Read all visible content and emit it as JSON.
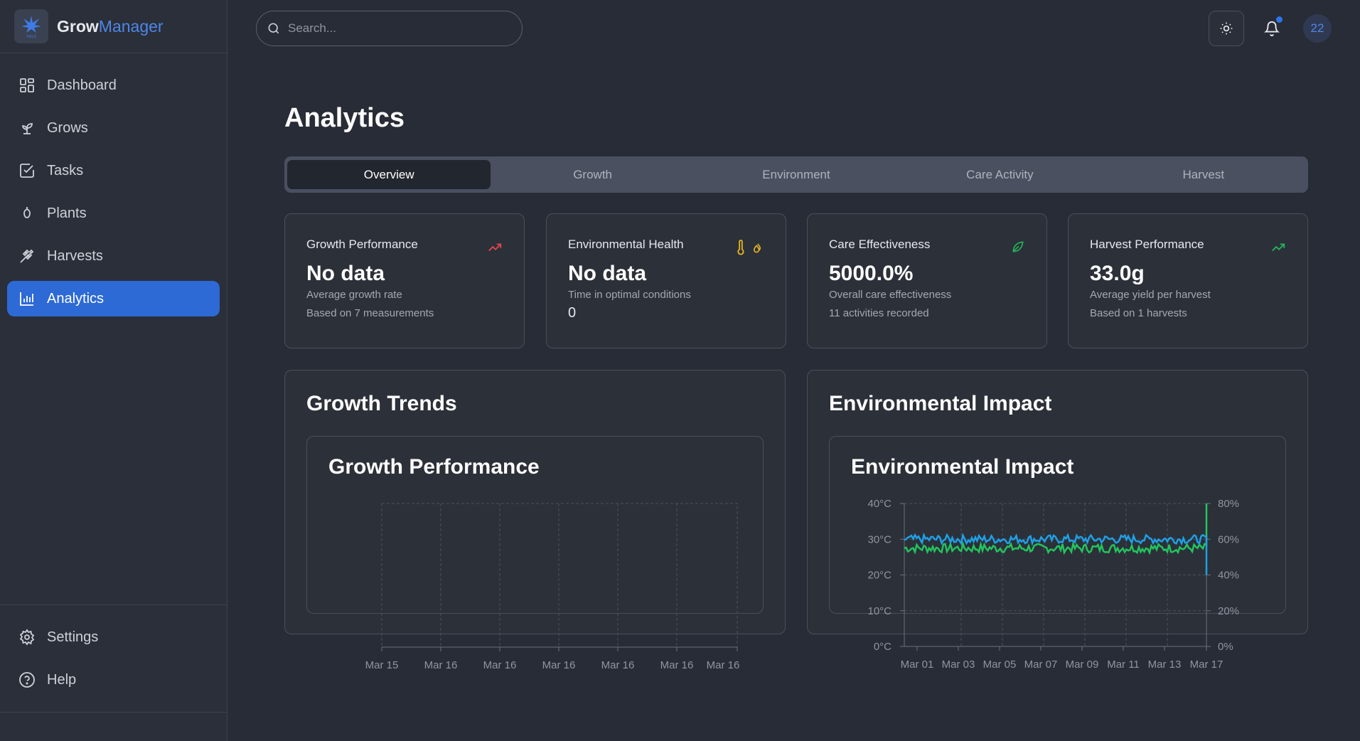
{
  "brand": {
    "name_part1": "Grow",
    "name_part2": "Manager"
  },
  "sidebar": {
    "items": [
      {
        "label": "Dashboard",
        "icon": "dashboard-icon"
      },
      {
        "label": "Grows",
        "icon": "sprout-icon"
      },
      {
        "label": "Tasks",
        "icon": "checkbox-icon"
      },
      {
        "label": "Plants",
        "icon": "plant-icon"
      },
      {
        "label": "Harvests",
        "icon": "wheat-icon"
      },
      {
        "label": "Analytics",
        "icon": "bar-chart-icon",
        "active": true
      }
    ],
    "bottom_items": [
      {
        "label": "Settings",
        "icon": "gear-icon"
      },
      {
        "label": "Help",
        "icon": "help-circle-icon"
      }
    ]
  },
  "search": {
    "placeholder": "Search..."
  },
  "header": {
    "avatar_text": "22"
  },
  "page": {
    "title": "Analytics"
  },
  "tabs": [
    {
      "label": "Overview",
      "active": true
    },
    {
      "label": "Growth"
    },
    {
      "label": "Environment"
    },
    {
      "label": "Care Activity"
    },
    {
      "label": "Harvest"
    }
  ],
  "cards": [
    {
      "title": "Growth Performance",
      "value": "No data",
      "sub": "Average growth rate",
      "sub2": "Based on 7 measurements",
      "icon": "trending-up-icon",
      "icon_color": "#e0464e"
    },
    {
      "title": "Environmental Health",
      "value": "No data",
      "sub": "Time in optimal conditions",
      "sub2": "0",
      "icon": "thermometer-droplet-icon",
      "icon_color": "#e6b422"
    },
    {
      "title": "Care Effectiveness",
      "value": "5000.0%",
      "sub": "Overall care effectiveness",
      "sub2": "11 activities recorded",
      "icon": "leaf-icon",
      "icon_color": "#22b45a"
    },
    {
      "title": "Harvest Performance",
      "value": "33.0g",
      "sub": "Average yield per harvest",
      "sub2": "Based on 1 harvests",
      "icon": "trending-up-icon",
      "icon_color": "#22b45a"
    }
  ],
  "panels": {
    "growth": {
      "title": "Growth Trends",
      "chart_title": "Growth Performance"
    },
    "environment": {
      "title": "Environmental Impact",
      "chart_title": "Environmental Impact"
    }
  },
  "chart_data": [
    {
      "type": "line",
      "title": "Growth Performance",
      "x_tick_labels": [
        "Mar 15",
        "Mar 16",
        "Mar 16",
        "Mar 16",
        "Mar 16",
        "Mar 16",
        "Mar 16"
      ],
      "series": [],
      "grid": true
    },
    {
      "type": "line",
      "title": "Environmental Impact",
      "x_tick_labels": [
        "Mar 01",
        "Mar 03",
        "Mar 05",
        "Mar 07",
        "Mar 09",
        "Mar 11",
        "Mar 13",
        "Mar 17"
      ],
      "y_left_ticks": [
        "0°C",
        "10°C",
        "20°C",
        "30°C",
        "40°C"
      ],
      "y_right_ticks": [
        "0%",
        "20%",
        "40%",
        "60%",
        "80%"
      ],
      "ylim_left": [
        0,
        40
      ],
      "ylim_right": [
        0,
        80
      ],
      "series": [
        {
          "axis": "left",
          "color": "#1ea0e6",
          "values_approx": 30,
          "noise": 1.2,
          "end_value": 20
        },
        {
          "axis": "right",
          "color": "#22c45e",
          "values_approx": 55,
          "noise": 2.5,
          "end_value": 80
        }
      ],
      "grid": true
    }
  ]
}
